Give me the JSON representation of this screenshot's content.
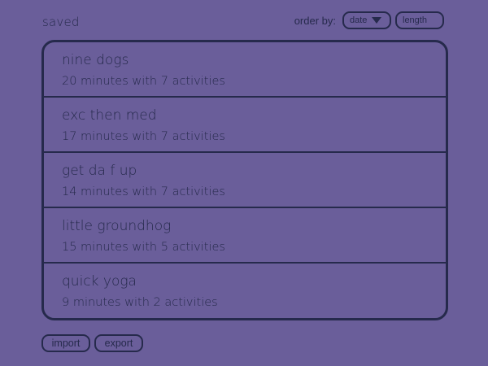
{
  "header": {
    "title": "saved",
    "order_label": "order by:",
    "sort_options": {
      "date": "date",
      "length": "length"
    },
    "active_sort": "date",
    "active_sort_icon": "triangle-down-icon"
  },
  "list": {
    "items": [
      {
        "name": "nine dogs",
        "detail": "20 minutes with 7 activities"
      },
      {
        "name": "exc then med",
        "detail": "17 minutes with 7 activities"
      },
      {
        "name": "get da f up",
        "detail": "14 minutes with 7 activities"
      },
      {
        "name": "little groundhog",
        "detail": "15 minutes with 5 activities"
      },
      {
        "name": "quick yoga",
        "detail": "9 minutes with 2 activities"
      }
    ]
  },
  "footer": {
    "import_label": "import",
    "export_label": "export"
  },
  "colors": {
    "background": "#6a5e9a",
    "ink": "#262a4c"
  }
}
